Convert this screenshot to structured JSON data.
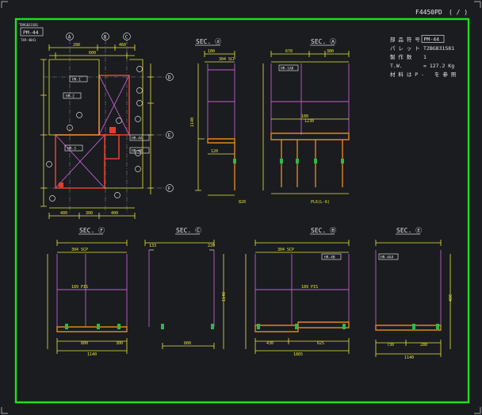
{
  "sheet": {
    "drawing_no": "F4450PD",
    "page": "( / )",
    "top_left": {
      "label1": "TB9G831S81",
      "part_box": "PM-44",
      "label2": "T49-4041"
    }
  },
  "info": {
    "rows": [
      {
        "key": "部 品 符 号",
        "value": "PM-44",
        "boxed": true
      },
      {
        "key": "パ レ ッ ト",
        "value": "T2BG831S81",
        "boxed": false
      },
      {
        "key": "製 作 数",
        "value": "1",
        "boxed": false
      },
      {
        "key": "T.W.",
        "value": "= 127.2  Kg",
        "boxed": false
      },
      {
        "key": "材 料 は  P -",
        "value": "を 参 照",
        "boxed": false
      }
    ]
  },
  "plan": {
    "grid_top": [
      "A",
      "B",
      "C"
    ],
    "grid_right": [
      "D",
      "E",
      "F"
    ],
    "member_tags": [
      "HR-1",
      "HR-2",
      "HR-3",
      "HR-4A",
      "HR-4B"
    ],
    "dims_top": [
      "280",
      "460",
      "600"
    ],
    "dims_bottom": [
      "400",
      "300",
      "400"
    ]
  },
  "sections": [
    {
      "id": "sec-d",
      "title": "SEC. ⓓ",
      "dims": [
        "180",
        "304 SCP",
        "120",
        "1140",
        "820"
      ],
      "tag": ""
    },
    {
      "id": "sec-a",
      "title": "SEC. Ⓐ",
      "dims": [
        "670",
        "380",
        "180",
        "1230",
        "PL6(L-6)"
      ],
      "tag": "HR-1A0"
    },
    {
      "id": "sec-f",
      "title": "SEC. Ⓕ",
      "dims": [
        "304 SCP",
        "189 PIS",
        "800",
        "1140",
        "300"
      ],
      "tag": ""
    },
    {
      "id": "sec-c",
      "title": "SEC. Ⓒ",
      "dims": [
        "133",
        "1140",
        "800",
        "220"
      ],
      "tag": ""
    },
    {
      "id": "sec-b",
      "title": "SEC. Ⓑ",
      "dims": [
        "304 SCP",
        "189 PIS",
        "1865",
        "430",
        "625"
      ],
      "tag": "HR-4B"
    },
    {
      "id": "sec-e",
      "title": "SEC. Ⓔ",
      "dims": [
        "1140",
        "730",
        "280",
        "400"
      ],
      "tag": "HR-4A4"
    }
  ]
}
